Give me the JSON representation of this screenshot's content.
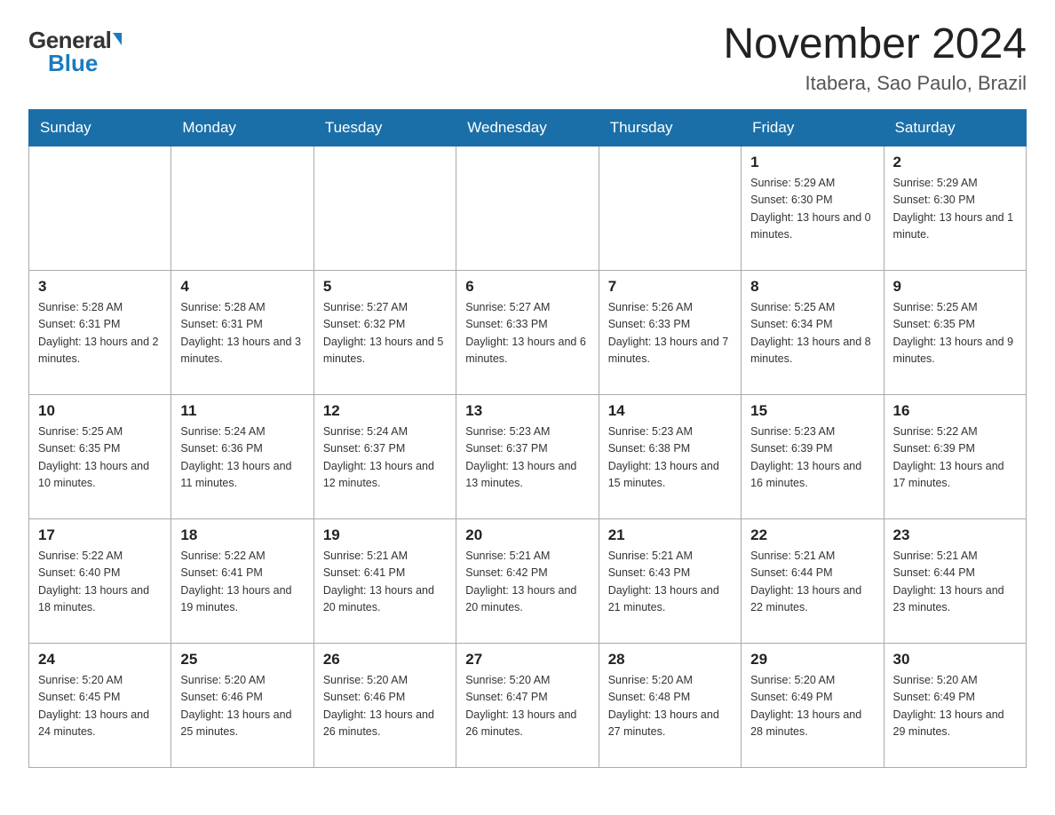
{
  "logo": {
    "general": "General",
    "blue": "Blue",
    "triangle": true
  },
  "header": {
    "title": "November 2024",
    "subtitle": "Itabera, Sao Paulo, Brazil"
  },
  "days_of_week": [
    "Sunday",
    "Monday",
    "Tuesday",
    "Wednesday",
    "Thursday",
    "Friday",
    "Saturday"
  ],
  "weeks": [
    {
      "days": [
        {
          "number": "",
          "empty": true
        },
        {
          "number": "",
          "empty": true
        },
        {
          "number": "",
          "empty": true
        },
        {
          "number": "",
          "empty": true
        },
        {
          "number": "",
          "empty": true
        },
        {
          "number": "1",
          "sunrise": "5:29 AM",
          "sunset": "6:30 PM",
          "daylight": "13 hours and 0 minutes."
        },
        {
          "number": "2",
          "sunrise": "5:29 AM",
          "sunset": "6:30 PM",
          "daylight": "13 hours and 1 minute."
        }
      ]
    },
    {
      "days": [
        {
          "number": "3",
          "sunrise": "5:28 AM",
          "sunset": "6:31 PM",
          "daylight": "13 hours and 2 minutes."
        },
        {
          "number": "4",
          "sunrise": "5:28 AM",
          "sunset": "6:31 PM",
          "daylight": "13 hours and 3 minutes."
        },
        {
          "number": "5",
          "sunrise": "5:27 AM",
          "sunset": "6:32 PM",
          "daylight": "13 hours and 5 minutes."
        },
        {
          "number": "6",
          "sunrise": "5:27 AM",
          "sunset": "6:33 PM",
          "daylight": "13 hours and 6 minutes."
        },
        {
          "number": "7",
          "sunrise": "5:26 AM",
          "sunset": "6:33 PM",
          "daylight": "13 hours and 7 minutes."
        },
        {
          "number": "8",
          "sunrise": "5:25 AM",
          "sunset": "6:34 PM",
          "daylight": "13 hours and 8 minutes."
        },
        {
          "number": "9",
          "sunrise": "5:25 AM",
          "sunset": "6:35 PM",
          "daylight": "13 hours and 9 minutes."
        }
      ]
    },
    {
      "days": [
        {
          "number": "10",
          "sunrise": "5:25 AM",
          "sunset": "6:35 PM",
          "daylight": "13 hours and 10 minutes."
        },
        {
          "number": "11",
          "sunrise": "5:24 AM",
          "sunset": "6:36 PM",
          "daylight": "13 hours and 11 minutes."
        },
        {
          "number": "12",
          "sunrise": "5:24 AM",
          "sunset": "6:37 PM",
          "daylight": "13 hours and 12 minutes."
        },
        {
          "number": "13",
          "sunrise": "5:23 AM",
          "sunset": "6:37 PM",
          "daylight": "13 hours and 13 minutes."
        },
        {
          "number": "14",
          "sunrise": "5:23 AM",
          "sunset": "6:38 PM",
          "daylight": "13 hours and 15 minutes."
        },
        {
          "number": "15",
          "sunrise": "5:23 AM",
          "sunset": "6:39 PM",
          "daylight": "13 hours and 16 minutes."
        },
        {
          "number": "16",
          "sunrise": "5:22 AM",
          "sunset": "6:39 PM",
          "daylight": "13 hours and 17 minutes."
        }
      ]
    },
    {
      "days": [
        {
          "number": "17",
          "sunrise": "5:22 AM",
          "sunset": "6:40 PM",
          "daylight": "13 hours and 18 minutes."
        },
        {
          "number": "18",
          "sunrise": "5:22 AM",
          "sunset": "6:41 PM",
          "daylight": "13 hours and 19 minutes."
        },
        {
          "number": "19",
          "sunrise": "5:21 AM",
          "sunset": "6:41 PM",
          "daylight": "13 hours and 20 minutes."
        },
        {
          "number": "20",
          "sunrise": "5:21 AM",
          "sunset": "6:42 PM",
          "daylight": "13 hours and 20 minutes."
        },
        {
          "number": "21",
          "sunrise": "5:21 AM",
          "sunset": "6:43 PM",
          "daylight": "13 hours and 21 minutes."
        },
        {
          "number": "22",
          "sunrise": "5:21 AM",
          "sunset": "6:44 PM",
          "daylight": "13 hours and 22 minutes."
        },
        {
          "number": "23",
          "sunrise": "5:21 AM",
          "sunset": "6:44 PM",
          "daylight": "13 hours and 23 minutes."
        }
      ]
    },
    {
      "days": [
        {
          "number": "24",
          "sunrise": "5:20 AM",
          "sunset": "6:45 PM",
          "daylight": "13 hours and 24 minutes."
        },
        {
          "number": "25",
          "sunrise": "5:20 AM",
          "sunset": "6:46 PM",
          "daylight": "13 hours and 25 minutes."
        },
        {
          "number": "26",
          "sunrise": "5:20 AM",
          "sunset": "6:46 PM",
          "daylight": "13 hours and 26 minutes."
        },
        {
          "number": "27",
          "sunrise": "5:20 AM",
          "sunset": "6:47 PM",
          "daylight": "13 hours and 26 minutes."
        },
        {
          "number": "28",
          "sunrise": "5:20 AM",
          "sunset": "6:48 PM",
          "daylight": "13 hours and 27 minutes."
        },
        {
          "number": "29",
          "sunrise": "5:20 AM",
          "sunset": "6:49 PM",
          "daylight": "13 hours and 28 minutes."
        },
        {
          "number": "30",
          "sunrise": "5:20 AM",
          "sunset": "6:49 PM",
          "daylight": "13 hours and 29 minutes."
        }
      ]
    }
  ],
  "labels": {
    "sunrise": "Sunrise:",
    "sunset": "Sunset:",
    "daylight": "Daylight:"
  }
}
